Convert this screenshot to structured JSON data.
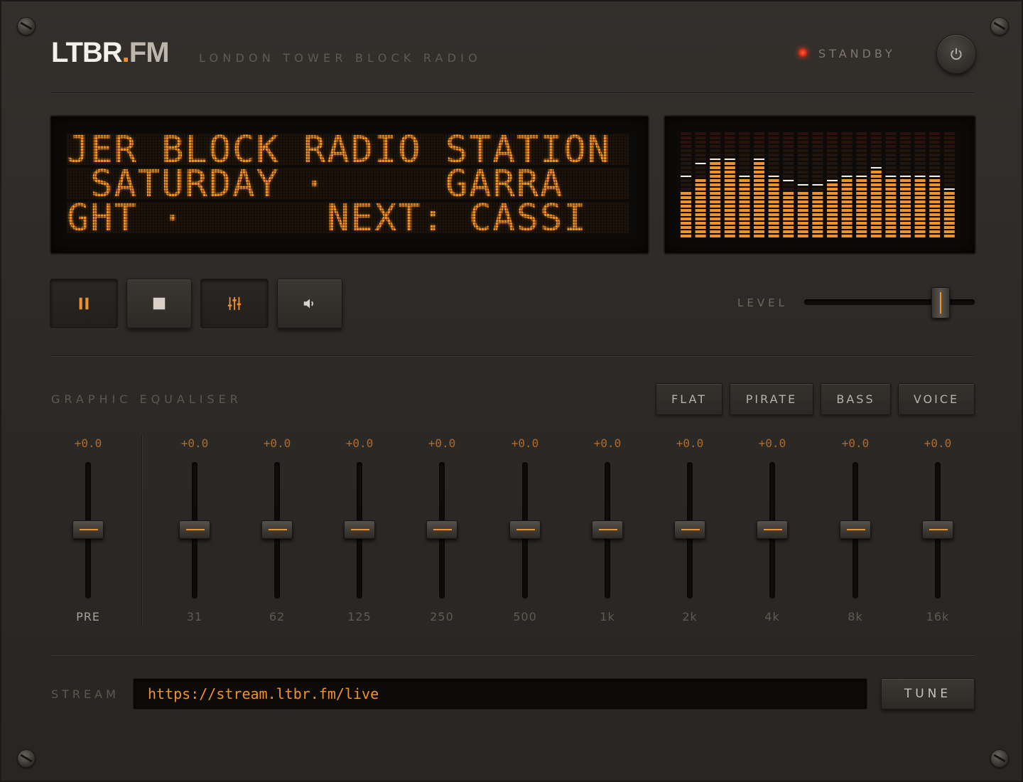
{
  "brand": {
    "logo_main": "LTBR",
    "logo_dot": ".",
    "logo_suffix": "FM",
    "tagline": "LONDON TOWER BLOCK RADIO"
  },
  "status": {
    "text": "STANDBY",
    "led_color": "#ff3b1e"
  },
  "display": {
    "lines": [
      "JER BLOCK RADIO STATION",
      " SATURDAY ·     GARRA",
      "GHT ·      NEXT: CASSI"
    ],
    "color": "#f0922a"
  },
  "spectrum": {
    "levels": [
      0.45,
      0.58,
      0.7,
      0.7,
      0.58,
      0.7,
      0.55,
      0.45,
      0.43,
      0.43,
      0.5,
      0.58,
      0.58,
      0.62,
      0.58,
      0.58,
      0.58,
      0.58,
      0.42
    ],
    "peaks": [
      0.58,
      0.68,
      0.72,
      0.72,
      0.58,
      0.72,
      0.58,
      0.52,
      0.48,
      0.48,
      0.52,
      0.58,
      0.58,
      0.62,
      0.58,
      0.58,
      0.58,
      0.58,
      0.44
    ]
  },
  "transport": {
    "pause": "pause-icon",
    "stop": "stop-icon",
    "eq": "equalizer-icon",
    "volume": "speaker-icon"
  },
  "level": {
    "label": "LEVEL",
    "value": 0.8
  },
  "eq": {
    "title": "GRAPHIC EQUALISER",
    "presets": [
      "FLAT",
      "PIRATE",
      "BASS",
      "VOICE"
    ],
    "bands": [
      {
        "label": "PRE",
        "value": "+0.0"
      },
      {
        "label": "31",
        "value": "+0.0"
      },
      {
        "label": "62",
        "value": "+0.0"
      },
      {
        "label": "125",
        "value": "+0.0"
      },
      {
        "label": "250",
        "value": "+0.0"
      },
      {
        "label": "500",
        "value": "+0.0"
      },
      {
        "label": "1k",
        "value": "+0.0"
      },
      {
        "label": "2k",
        "value": "+0.0"
      },
      {
        "label": "4k",
        "value": "+0.0"
      },
      {
        "label": "8k",
        "value": "+0.0"
      },
      {
        "label": "16k",
        "value": "+0.0"
      }
    ]
  },
  "stream": {
    "label": "STREAM",
    "url": "https://stream.ltbr.fm/live",
    "tune_label": "TUNE"
  },
  "colors": {
    "accent": "#f0922a",
    "panel": "#2e2b27",
    "lcd_bg": "#0d0b09"
  }
}
